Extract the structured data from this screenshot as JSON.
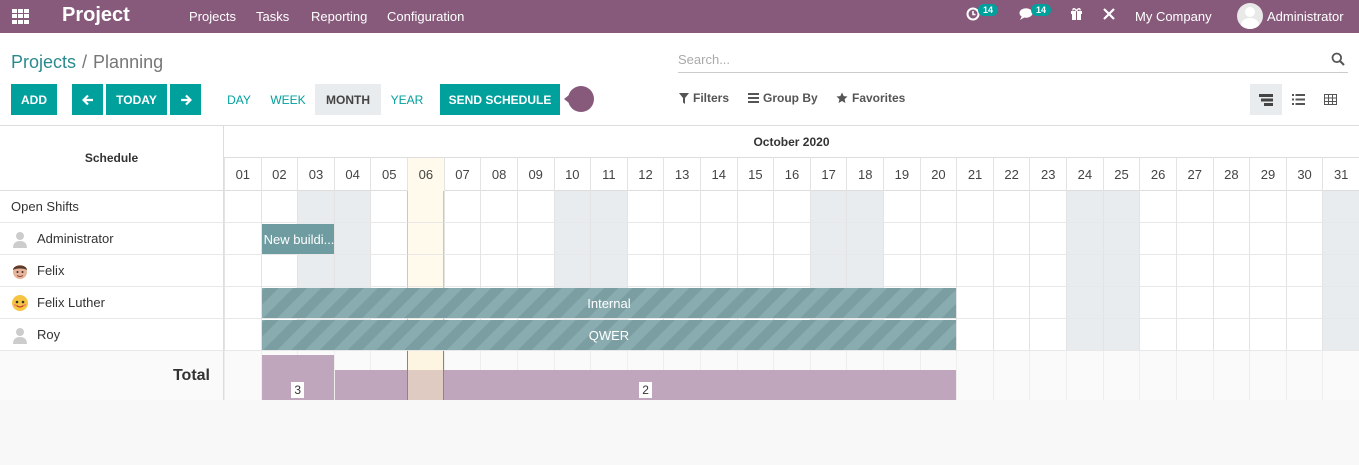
{
  "app": {
    "title": "Project"
  },
  "menu": [
    "Projects",
    "Tasks",
    "Reporting",
    "Configuration"
  ],
  "systray": {
    "activity_count": "14",
    "messages_count": "14",
    "company": "My Company",
    "user": "Administrator"
  },
  "breadcrumb": {
    "parent": "Projects",
    "separator": "/",
    "current": "Planning"
  },
  "search": {
    "placeholder": "Search..."
  },
  "buttons": {
    "add": "ADD",
    "today": "TODAY",
    "send_schedule": "SEND SCHEDULE"
  },
  "scales": [
    "DAY",
    "WEEK",
    "MONTH",
    "YEAR"
  ],
  "active_scale": "MONTH",
  "filters": {
    "filters": "Filters",
    "group_by": "Group By",
    "favorites": "Favorites"
  },
  "gantt": {
    "header_label": "Schedule",
    "month": "October 2020",
    "days": [
      "01",
      "02",
      "03",
      "04",
      "05",
      "06",
      "07",
      "08",
      "09",
      "10",
      "11",
      "12",
      "13",
      "14",
      "15",
      "16",
      "17",
      "18",
      "19",
      "20",
      "21",
      "22",
      "23",
      "24",
      "25",
      "26",
      "27",
      "28",
      "29",
      "30",
      "31"
    ],
    "today": "06",
    "weekend_days": [
      "03",
      "04",
      "10",
      "11",
      "17",
      "18",
      "24",
      "25",
      "31"
    ],
    "rows": [
      {
        "label": "Open Shifts",
        "avatar": "none"
      },
      {
        "label": "Administrator",
        "avatar": "default-user"
      },
      {
        "label": "Felix",
        "avatar": "man-face"
      },
      {
        "label": "Felix Luther",
        "avatar": "smiley-face"
      },
      {
        "label": "Roy",
        "avatar": "default-user"
      }
    ],
    "pills": [
      {
        "row": 1,
        "label": "New buildi...",
        "start": "02",
        "end": "03",
        "style": "plain"
      },
      {
        "row": 3,
        "label": "Internal",
        "start": "02",
        "end": "20",
        "style": "hatch"
      },
      {
        "row": 4,
        "label": "QWER",
        "start": "02",
        "end": "20",
        "style": "hatch"
      }
    ],
    "total_label": "Total",
    "totals": [
      {
        "start": "02",
        "end": "03",
        "value": "3",
        "level": 3
      },
      {
        "start": "04",
        "end": "20",
        "value": "2",
        "level": 2
      }
    ],
    "colors": {
      "brand": "#875a7b",
      "accent": "#00a09d",
      "pill": "#7b9ea3",
      "total_bar": "#c0a6bc"
    }
  }
}
